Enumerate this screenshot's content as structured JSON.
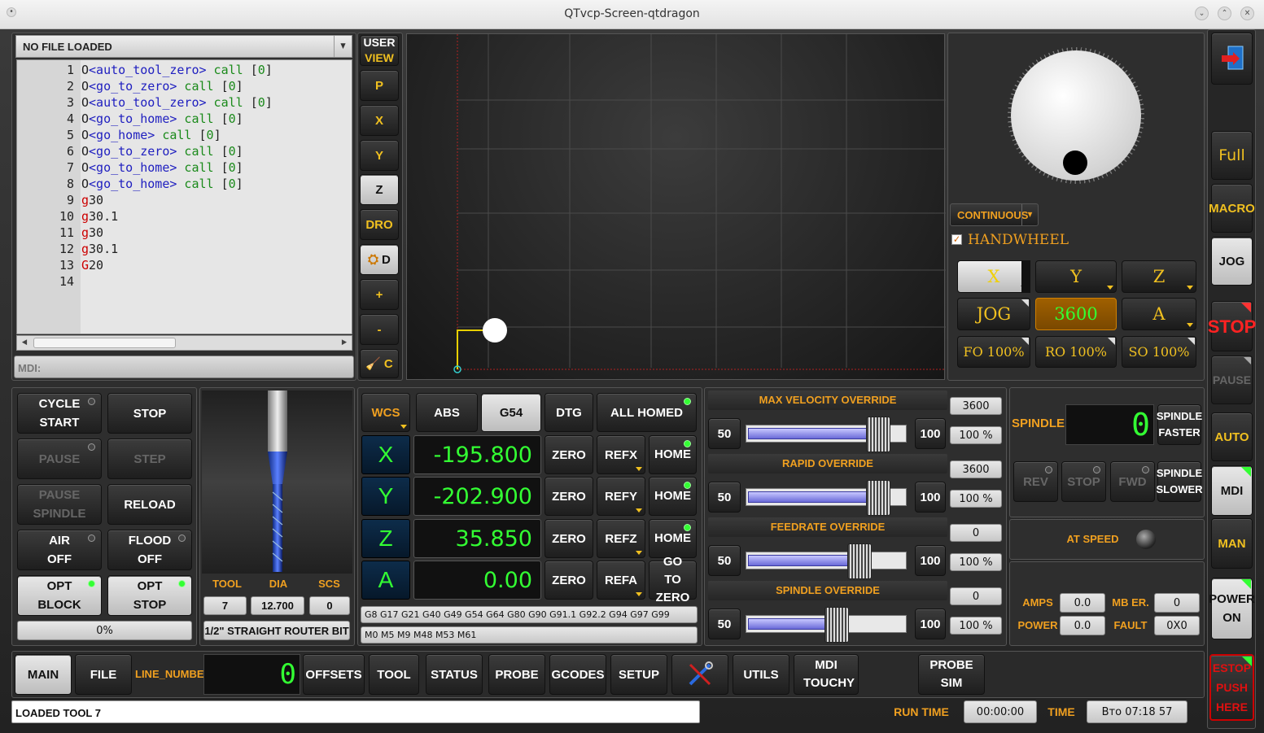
{
  "window": {
    "title": "QTvcp-Screen-qtdragon"
  },
  "file": {
    "name": "NO FILE LOADED"
  },
  "gcode_lines": [
    {
      "n": "1",
      "parts": [
        [
          "kw",
          "O"
        ],
        [
          "blue",
          "<auto_tool_zero>"
        ],
        [
          "grn",
          " call "
        ],
        [
          "kw",
          "["
        ],
        [
          "grn",
          "0"
        ],
        [
          "kw",
          "]"
        ]
      ]
    },
    {
      "n": "2",
      "parts": [
        [
          "kw",
          "O"
        ],
        [
          "blue",
          "<go_to_zero>"
        ],
        [
          "grn",
          " call "
        ],
        [
          "kw",
          "["
        ],
        [
          "grn",
          "0"
        ],
        [
          "kw",
          "]"
        ]
      ]
    },
    {
      "n": "3",
      "parts": [
        [
          "kw",
          "O"
        ],
        [
          "blue",
          "<auto_tool_zero>"
        ],
        [
          "grn",
          " call "
        ],
        [
          "kw",
          "["
        ],
        [
          "grn",
          "0"
        ],
        [
          "kw",
          "]"
        ]
      ]
    },
    {
      "n": "4",
      "parts": [
        [
          "kw",
          "O"
        ],
        [
          "blue",
          "<go_to_home>"
        ],
        [
          "grn",
          " call "
        ],
        [
          "kw",
          "["
        ],
        [
          "grn",
          "0"
        ],
        [
          "kw",
          "]"
        ]
      ]
    },
    {
      "n": "5",
      "parts": [
        [
          "kw",
          "O"
        ],
        [
          "blue",
          "<go_home>"
        ],
        [
          "grn",
          " call "
        ],
        [
          "kw",
          "["
        ],
        [
          "grn",
          "0"
        ],
        [
          "kw",
          "]"
        ]
      ]
    },
    {
      "n": "6",
      "parts": [
        [
          "kw",
          "O"
        ],
        [
          "blue",
          "<go_to_zero>"
        ],
        [
          "grn",
          " call "
        ],
        [
          "kw",
          "["
        ],
        [
          "grn",
          "0"
        ],
        [
          "kw",
          "]"
        ]
      ]
    },
    {
      "n": "7",
      "parts": [
        [
          "kw",
          "O"
        ],
        [
          "blue",
          "<go_to_home>"
        ],
        [
          "grn",
          " call "
        ],
        [
          "kw",
          "["
        ],
        [
          "grn",
          "0"
        ],
        [
          "kw",
          "]"
        ]
      ]
    },
    {
      "n": "8",
      "parts": [
        [
          "kw",
          "O"
        ],
        [
          "blue",
          "<go_to_home>"
        ],
        [
          "grn",
          " call "
        ],
        [
          "kw",
          "["
        ],
        [
          "grn",
          "0"
        ],
        [
          "kw",
          "]"
        ]
      ]
    },
    {
      "n": "9",
      "parts": [
        [
          "red",
          "g"
        ],
        [
          "kw",
          "30"
        ]
      ]
    },
    {
      "n": "10",
      "parts": [
        [
          "red",
          "g"
        ],
        [
          "kw",
          "30.1"
        ]
      ]
    },
    {
      "n": "11",
      "parts": [
        [
          "red",
          "g"
        ],
        [
          "kw",
          "30"
        ]
      ]
    },
    {
      "n": "12",
      "parts": [
        [
          "red",
          "g"
        ],
        [
          "kw",
          "30.1"
        ]
      ]
    },
    {
      "n": "13",
      "parts": [
        [
          "red",
          "G"
        ],
        [
          "kw",
          "20"
        ]
      ]
    },
    {
      "n": "14",
      "parts": []
    }
  ],
  "mdi": {
    "label": "MDI:"
  },
  "view_buttons": {
    "user_view_1": "USER",
    "user_view_2": "VIEW",
    "p": "P",
    "x": "X",
    "y": "Y",
    "z": "Z",
    "dro": "DRO",
    "d": "D",
    "plus": "+",
    "minus": "-",
    "c": "C"
  },
  "jog_panel": {
    "mode": "CONTINUOUS",
    "handwheel_label": "HANDWHEEL",
    "axes": [
      "X",
      "Y",
      "Z"
    ],
    "jog_label": "JOG",
    "jog_rate": "3600",
    "axis_a": "A",
    "fo": "FO 100%",
    "ro": "RO 100%",
    "so": "SO 100%"
  },
  "right_side": {
    "full": "Full",
    "macro": "MACRO",
    "jog": "JOG",
    "stop": "STOP",
    "pause": "PAUSE",
    "auto": "AUTO",
    "mdi": "MDI",
    "man": "MAN",
    "power1": "POWER",
    "power2": "ON",
    "estop1": "ESTOP",
    "estop2": "PUSH",
    "estop3": "HERE"
  },
  "control": {
    "cycle1": "CYCLE",
    "cycle2": "START",
    "stop": "STOP",
    "pause": "PAUSE",
    "step": "STEP",
    "pause_spindle1": "PAUSE",
    "pause_spindle2": "SPINDLE",
    "reload": "RELOAD",
    "air1": "AIR",
    "air2": "OFF",
    "flood1": "FLOOD",
    "flood2": "OFF",
    "opt_block1": "OPT",
    "opt_block2": "BLOCK",
    "opt_stop1": "OPT",
    "opt_stop2": "STOP",
    "progress": "0%"
  },
  "tool": {
    "tool_label": "TOOL",
    "dia_label": "DIA",
    "scs_label": "SCS",
    "tool": "7",
    "dia": "12.700",
    "scs": "0",
    "desc": "1/2\" STRAIGHT ROUTER BIT"
  },
  "dro": {
    "wcs": "WCS",
    "abs": "ABS",
    "g54": "G54",
    "dtg": "DTG",
    "all_homed": "ALL HOMED",
    "axes": [
      {
        "axis": "X",
        "value": "-195.800",
        "ref": "REFX",
        "home": "HOME"
      },
      {
        "axis": "Y",
        "value": "-202.900",
        "ref": "REFY",
        "home": "HOME"
      },
      {
        "axis": "Z",
        "value": "35.850",
        "ref": "REFZ",
        "home": "HOME"
      },
      {
        "axis": "A",
        "value": "0.00",
        "ref": "REFA",
        "home": "GO TO ZERO"
      }
    ],
    "zero": "ZERO",
    "gcodes": "G8 G17 G21 G40 G49 G54 G64 G80 G90 G91.1 G92.2 G94 G97 G99",
    "mcodes": "M0 M5 M9 M48 M53 M61"
  },
  "overrides": [
    {
      "title": "MAX VELOCITY OVERRIDE",
      "value": "3600",
      "pct": "100 %",
      "fill": 0.82
    },
    {
      "title": "RAPID OVERRIDE",
      "value": "3600",
      "pct": "100 %",
      "fill": 0.82
    },
    {
      "title": "FEEDRATE OVERRIDE",
      "value": "0",
      "pct": "100 %",
      "fill": 0.7
    },
    {
      "title": "SPINDLE OVERRIDE",
      "value": "0",
      "pct": "100 %",
      "fill": 0.55
    }
  ],
  "override_min": "50",
  "override_max": "100",
  "spindle": {
    "label": "SPINDLE",
    "rpm": "0",
    "faster1": "SPINDLE",
    "faster2": "FASTER",
    "slower1": "SPINDLE",
    "slower2": "SLOWER",
    "rev": "REV",
    "stop": "STOP",
    "fwd": "FWD",
    "at_speed": "AT SPEED",
    "amps_label": "AMPS",
    "amps": "0.0",
    "mb_er_label": "MB ER.",
    "mb_er": "0",
    "power_label": "POWER",
    "power": "0.0",
    "fault_label": "FAULT",
    "fault": "0X0"
  },
  "tabs": [
    {
      "label": "MAIN",
      "active": true
    },
    {
      "label": "FILE"
    },
    {
      "label": "OFFSETS"
    },
    {
      "label": "TOOL"
    },
    {
      "label": "STATUS"
    },
    {
      "label": "PROBE"
    },
    {
      "label": "GCODES"
    },
    {
      "label": "SETUP"
    },
    {
      "label": "UTILS"
    },
    {
      "label": "MDI TOUCHY"
    },
    {
      "label": "PROBE SIM"
    }
  ],
  "line_number": {
    "label": "LINE_NUMBER",
    "value": "0"
  },
  "status": {
    "message": "LOADED TOOL 7",
    "run_time_label": "RUN TIME",
    "run_time": "00:00:00",
    "time_label": "TIME",
    "time": "Вто 07:18 57"
  }
}
